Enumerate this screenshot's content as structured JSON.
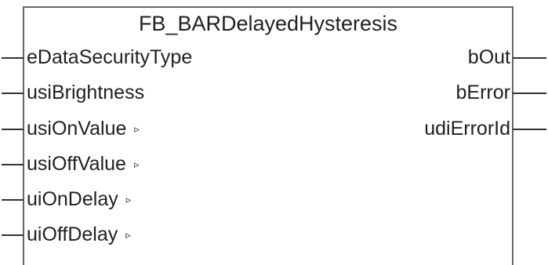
{
  "function_block": {
    "name": "FB_BARDelayedHysteresis",
    "inputs": [
      {
        "name": "eDataSecurityType",
        "marker": ""
      },
      {
        "name": "usiBrightness",
        "marker": ""
      },
      {
        "name": "usiOnValue",
        "marker": "▹"
      },
      {
        "name": "usiOffValue",
        "marker": "▹"
      },
      {
        "name": "uiOnDelay",
        "marker": "▹"
      },
      {
        "name": "uiOffDelay",
        "marker": "▹"
      }
    ],
    "outputs": [
      {
        "name": "bOut"
      },
      {
        "name": "bError"
      },
      {
        "name": "udiErrorId"
      }
    ]
  },
  "colors": {
    "border": "#666666",
    "pin_line": "#333333",
    "text": "#1f1f1f",
    "background": "#ffffff"
  }
}
